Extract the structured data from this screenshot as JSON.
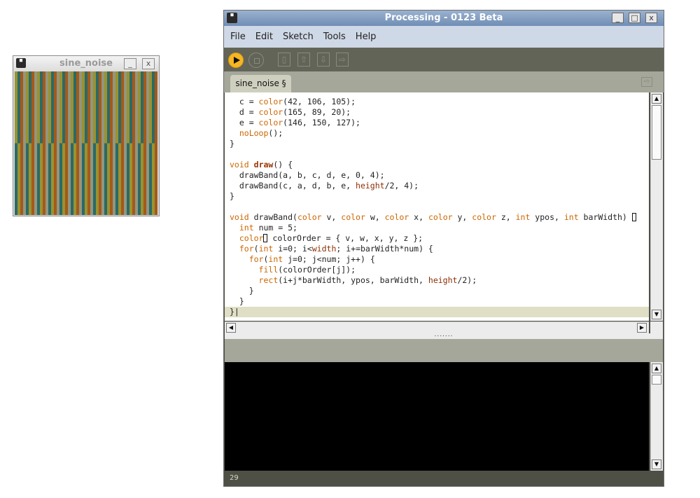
{
  "sketch_window": {
    "title": "sine_noise",
    "icon": "processing-logo-icon",
    "minimize_label": "_",
    "close_label": "x",
    "band_top_colors": [
      "#9a9231",
      "#2a6a69",
      "#a5591a",
      "#92967f"
    ],
    "band_bottom_colors": [
      "#2a6a69",
      "#9a9231",
      "#a5591a",
      "#92967f"
    ]
  },
  "ide": {
    "title": "Processing - 0123 Beta",
    "minimize_label": "_",
    "maximize_label": "□",
    "close_label": "x",
    "menu": [
      "File",
      "Edit",
      "Sketch",
      "Tools",
      "Help"
    ],
    "toolbar": {
      "run_icon": "run-play-icon",
      "stop_icon": "stop-icon",
      "new_icon": "new-file-icon",
      "open_icon": "open-up-arrow-icon",
      "save_icon": "save-down-arrow-icon",
      "export_icon": "export-arrow-icon",
      "new_glyph": "▯",
      "open_glyph": "⇧",
      "save_glyph": "⇩",
      "export_glyph": "⇨"
    },
    "tab": {
      "label": "sine_noise §",
      "arrow_glyph": "⇨"
    },
    "code_lines": [
      "  c = color(42, 106, 105);",
      "  d = color(165, 89, 20);",
      "  e = color(146, 150, 127);",
      "  noLoop();",
      "}",
      "",
      "void draw() {",
      "  drawBand(a, b, c, d, e, 0, 4);",
      "  drawBand(c, a, d, b, e, height/2, 4);",
      "}",
      "",
      "void drawBand(color v, color w, color x, color y, color z, int ypos, int barWidth) {",
      "  int num = 5;",
      "  color[] colorOrder = { v, w, x, y, z };",
      "  for(int i=0; i<width; i+=barWidth*num) {",
      "    for(int j=0; j<num; j++) {",
      "      fill(colorOrder[j]);",
      "      rect(i+j*barWidth, ypos, barWidth, height/2);",
      "    }",
      "  }",
      "}"
    ],
    "divider_label": ".......",
    "status_line": "29"
  }
}
